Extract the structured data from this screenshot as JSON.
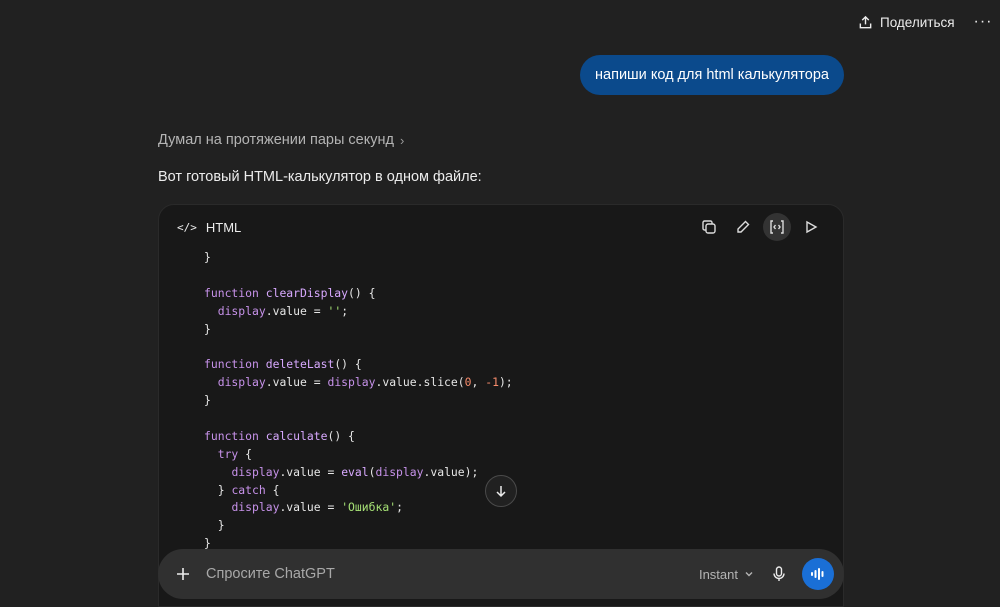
{
  "topbar": {
    "share_label": "Поделиться",
    "more_label": "···"
  },
  "conversation": {
    "user_message": "напиши код для html калькулятора",
    "thought_label": "Думал на протяжении пары секунд",
    "assistant_intro": "Вот готовый HTML-калькулятор в одном файле:"
  },
  "code_block": {
    "language": "HTML",
    "lang_icon": "</>",
    "actions": [
      "copy-icon",
      "edit-icon",
      "code-view-icon",
      "run-icon"
    ]
  },
  "composer": {
    "placeholder": "Спросите ChatGPT",
    "model_label": "Instant"
  },
  "colors": {
    "background": "#212121",
    "user_bubble": "#0b4a8c",
    "code_bg": "#181818",
    "voice_button": "#1a6fd6"
  }
}
